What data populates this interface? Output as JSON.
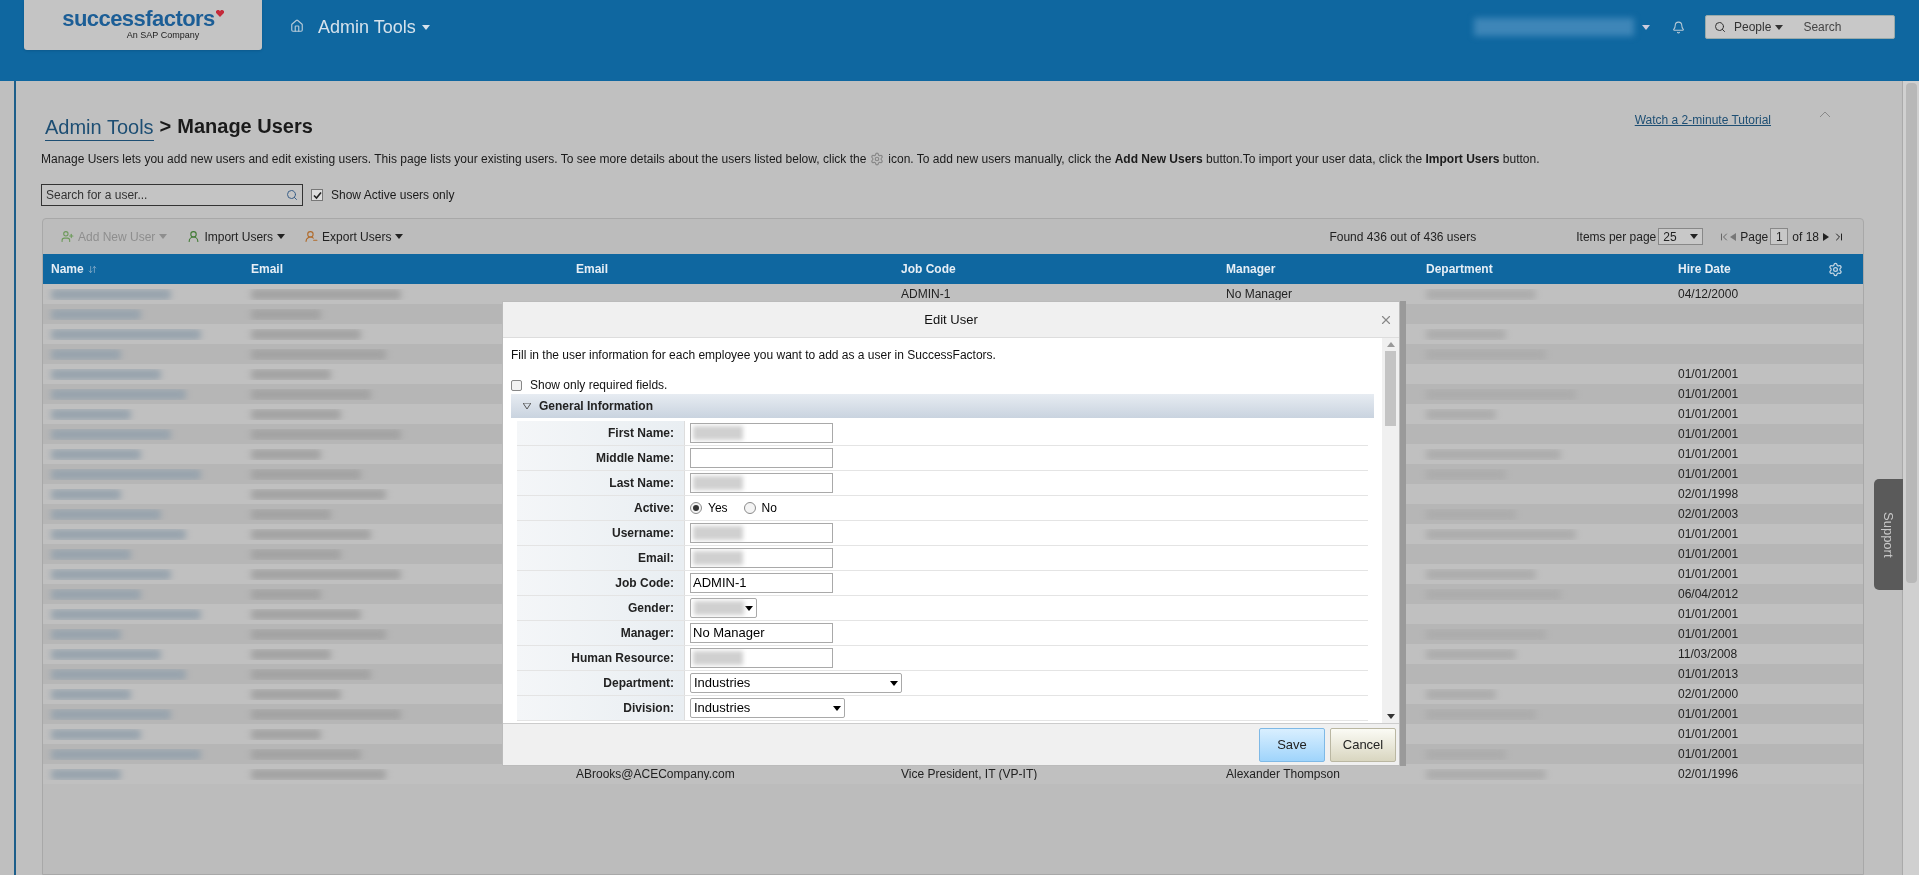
{
  "header": {
    "logo": {
      "brand": "successfactors",
      "tagline": "An SAP Company"
    },
    "nav_title": "Admin Tools",
    "search": {
      "scope": "People",
      "placeholder": "Search"
    }
  },
  "page": {
    "breadcrumb_link": "Admin Tools",
    "separator": ">",
    "title": "Manage Users",
    "tutorial_link": "Watch a 2-minute Tutorial",
    "description_before": "Manage Users lets you add new users and edit existing users. This page lists your existing users. To see more details about the users listed below, click the",
    "description_after": "icon. To add new users manually, click the **Add New Users** button.To import your user data, click the **Import Users** button.",
    "search_field": {
      "placeholder": "Search for a user..."
    },
    "active_filter": {
      "label": "Show Active users only",
      "checked": true
    }
  },
  "toolbar": {
    "buttons": [
      {
        "label": "Add New User",
        "disabled": true,
        "kind": "add"
      },
      {
        "label": "Import Users",
        "disabled": false,
        "kind": "import"
      },
      {
        "label": "Export Users",
        "disabled": false,
        "kind": "export"
      }
    ],
    "found": "Found 436 out of 436 users",
    "items_per_page_label": "Items per page",
    "items_per_page": "25",
    "page_label": "Page",
    "page": "1",
    "page_total": "of 18"
  },
  "table": {
    "columns": [
      "Name",
      "Email",
      "Email",
      "Job Code",
      "Manager",
      "Department",
      "Hire Date"
    ],
    "rows": [
      {
        "job_code": "ADMIN-1",
        "manager": "No Manager",
        "hire_date": "04/12/2000"
      },
      {},
      {},
      {},
      {
        "hire_date": "01/01/2001"
      },
      {
        "hire_date": "01/01/2001"
      },
      {
        "hire_date": "01/01/2001"
      },
      {
        "hire_date": "01/01/2001"
      },
      {
        "hire_date": "01/01/2001"
      },
      {
        "hire_date": "01/01/2001"
      },
      {
        "hire_date": "02/01/1998"
      },
      {
        "hire_date": "02/01/2003"
      },
      {
        "hire_date": "01/01/2001"
      },
      {
        "hire_date": "01/01/2001"
      },
      {
        "hire_date": "01/01/2001"
      },
      {
        "hire_date": "06/04/2012"
      },
      {
        "hire_date": "01/01/2001"
      },
      {
        "hire_date": "01/01/2001"
      },
      {
        "hire_date": "11/03/2008"
      },
      {
        "hire_date": "01/01/2013"
      },
      {
        "hire_date": "02/01/2000"
      },
      {
        "hire_date": "01/01/2001"
      },
      {
        "hire_date": "01/01/2001"
      },
      {
        "hire_date": "01/01/2001"
      },
      {
        "email_2": "ABrooks@ACECompany.com",
        "job_code": "Vice President, IT (VP-IT)",
        "manager": "Alexander Thompson",
        "hire_date": "02/01/1996"
      }
    ]
  },
  "dialog": {
    "title": "Edit User",
    "intro": "Fill in the user information for each employee you want to add as a user in SuccessFactors.",
    "required_only": {
      "label": "Show only required fields.",
      "checked": false
    },
    "section": {
      "title": "General Information",
      "expanded": true
    },
    "fields": [
      {
        "label": "First Name:",
        "kind": "text",
        "redacted": true
      },
      {
        "label": "Middle Name:",
        "kind": "text",
        "redacted": false
      },
      {
        "label": "Last Name:",
        "kind": "text",
        "redacted": true
      },
      {
        "label": "Active:",
        "kind": "radio",
        "options": [
          {
            "label": "Yes",
            "selected": true
          },
          {
            "label": "No",
            "selected": false
          }
        ]
      },
      {
        "label": "Username:",
        "kind": "text",
        "redacted": true
      },
      {
        "label": "Email:",
        "kind": "text",
        "redacted": true
      },
      {
        "label": "Job Code:",
        "kind": "text",
        "redacted": false,
        "value": "ADMIN-1"
      },
      {
        "label": "Gender:",
        "kind": "select",
        "redacted": true
      },
      {
        "label": "Manager:",
        "kind": "text",
        "redacted": false,
        "value": "No Manager"
      },
      {
        "label": "Human Resource:",
        "kind": "text",
        "redacted": true
      },
      {
        "label": "Department:",
        "kind": "select",
        "redacted": false,
        "value": "Industries"
      },
      {
        "label": "Division:",
        "kind": "select",
        "redacted": false,
        "value": "Industries"
      }
    ],
    "buttons": [
      {
        "label": "Save",
        "kind": "primary"
      },
      {
        "label": "Cancel",
        "kind": "secondary"
      }
    ]
  },
  "support_tab": "Support"
}
